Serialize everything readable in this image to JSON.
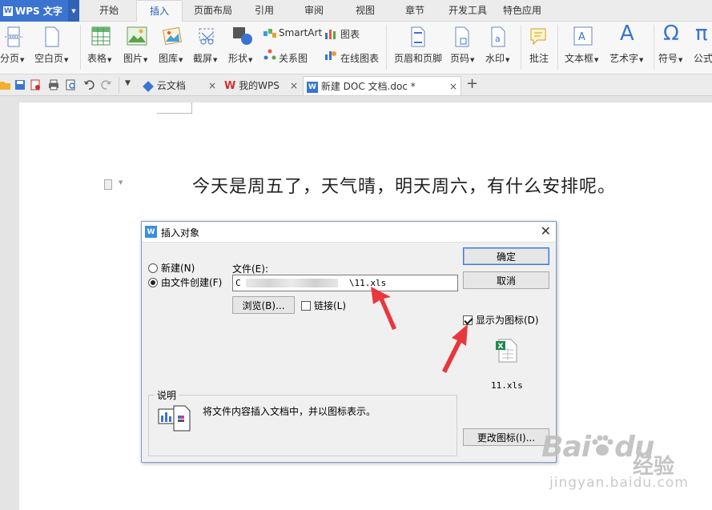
{
  "app": {
    "name": "WPS 文字",
    "logo_letter": "W"
  },
  "menu": {
    "tabs": [
      "开始",
      "插入",
      "页面布局",
      "引用",
      "审阅",
      "视图",
      "章节",
      "开发工具",
      "特色应用"
    ],
    "active": "插入"
  },
  "ribbon": {
    "fenye": "分页",
    "kongbaiye": "空白页",
    "biaoge": "表格",
    "tupian": "图片",
    "tuku": "图库",
    "jieping": "截屏",
    "xingzhuang": "形状",
    "smartart": "SmartArt",
    "tubiao": "图表",
    "guanxitu": "关系图",
    "zaixiantubiao": "在线图表",
    "yemeiyejiao": "页眉和页脚",
    "yema": "页码",
    "shuiyin": "水印",
    "pizhu": "批注",
    "wenbenkuang": "文本框",
    "yishuzi": "艺术字",
    "fuhao": "符号",
    "gongshi": "公式",
    "omega_glyph": "Ω",
    "pi_glyph": "π",
    "art_glyph": "A"
  },
  "doc_tabs": {
    "tab1": "云文档",
    "tab2": "我的WPS",
    "tab3": "新建 DOC 文档.doc *",
    "close_glyph": "×",
    "add_glyph": "+"
  },
  "document": {
    "text": "今天是周五了，天气晴，明天周六，有什么安排呢。"
  },
  "dialog": {
    "title": "插入对象",
    "close_glyph": "✕",
    "radio_new": "新建(N)",
    "radio_from_file": "由文件创建(F)",
    "file_label": "文件(E):",
    "file_value_start": "C",
    "file_value_end": "\\11.xls",
    "browse_button": "浏览(B)...",
    "link_label": "链接(L)",
    "ok_button": "确定",
    "cancel_button": "取消",
    "display_as_icon": "显示为图标(D)",
    "file_icon_caption": "11.xls",
    "change_icon_button": "更改图标(I)...",
    "description_group": "说明",
    "description_text": "将文件内容插入文档中，并以图标表示。",
    "states": {
      "radio_from_file_selected": true,
      "link_checked": false,
      "display_as_icon_checked": true
    }
  },
  "annotation_color": "#e8383d",
  "watermark": {
    "text_latin": "Bai",
    "text_du": "du",
    "text_cn": "经验",
    "subtext": "jingyan.baidu.com"
  }
}
